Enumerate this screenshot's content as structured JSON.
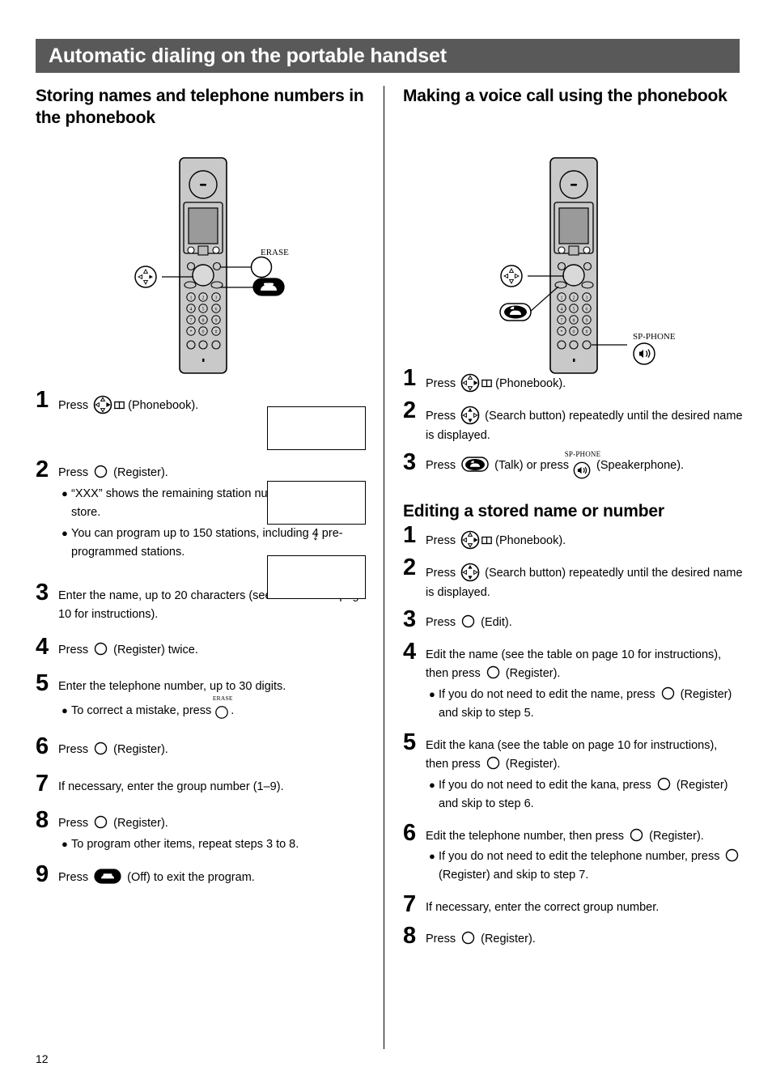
{
  "page": {
    "number": "12",
    "header_title": "Automatic dialing on the portable handset",
    "header_bg": "#595959",
    "header_fg": "#ffffff"
  },
  "left_column": {
    "section_title": "Storing names and telephone numbers in the phonebook",
    "illustration": {
      "name": "portable-handset-storing",
      "callouts": [
        {
          "label": "",
          "icon": "navigator-icon"
        },
        {
          "label": "ERASE",
          "icon": "erase-button-icon"
        },
        {
          "label": "",
          "icon": "talk-off-button-icon"
        }
      ],
      "keypad": [
        "1",
        "2",
        "3",
        "4",
        "5",
        "6",
        "7",
        "8",
        "9",
        "*",
        "0",
        "#"
      ]
    },
    "displays": [
      {
        "name": "lcd-display-1",
        "text": ""
      },
      {
        "name": "lcd-display-2",
        "text": ""
      },
      {
        "name": "lcd-display-3",
        "text": ""
      }
    ],
    "display_arrow": "↓",
    "steps": [
      {
        "num": "1",
        "parts": [
          {
            "t": "text",
            "v": "Press "
          },
          {
            "t": "icon",
            "v": "navigator-phonebook-icon"
          },
          {
            "t": "text",
            "v": " (Phonebook)."
          }
        ],
        "subs": []
      },
      {
        "num": "2",
        "parts": [
          {
            "t": "text",
            "v": "Press "
          },
          {
            "t": "icon",
            "v": "register-button-icon"
          },
          {
            "t": "text",
            "v": " (Register)."
          }
        ],
        "subs": [
          {
            "v": "“XXX” shows the remaining station numbers you can store."
          },
          {
            "v": "You can program up to 150 stations, including 4 pre-programmed stations."
          }
        ]
      },
      {
        "num": "3",
        "parts": [
          {
            "t": "text",
            "v": "Enter the name, up to 20 characters (see the table on page 10 for instructions)."
          }
        ],
        "subs": []
      },
      {
        "num": "4",
        "parts": [
          {
            "t": "text",
            "v": "Press "
          },
          {
            "t": "icon",
            "v": "register-button-icon"
          },
          {
            "t": "text",
            "v": " (Register) twice."
          }
        ],
        "subs": []
      },
      {
        "num": "5",
        "parts": [
          {
            "t": "text",
            "v": "Enter the telephone number, up to 30 digits."
          }
        ],
        "subs": [
          {
            "pre": "To correct a mistake, press ",
            "icon": "erase-button-icon",
            "icon_label": "ERASE",
            "post": "."
          }
        ]
      },
      {
        "num": "6",
        "parts": [
          {
            "t": "text",
            "v": "Press "
          },
          {
            "t": "icon",
            "v": "register-button-icon"
          },
          {
            "t": "text",
            "v": " (Register)."
          }
        ],
        "subs": []
      },
      {
        "num": "7",
        "parts": [
          {
            "t": "text",
            "v": "If necessary, enter the group number (1–9)."
          }
        ],
        "subs": []
      },
      {
        "num": "8",
        "parts": [
          {
            "t": "text",
            "v": "Press "
          },
          {
            "t": "icon",
            "v": "register-button-icon"
          },
          {
            "t": "text",
            "v": " (Register)."
          }
        ],
        "subs": [
          {
            "v": "To program other items, repeat steps 3 to 8."
          }
        ]
      },
      {
        "num": "9",
        "parts": [
          {
            "t": "text",
            "v": "Press "
          },
          {
            "t": "icon",
            "v": "talk-off-button-icon"
          },
          {
            "t": "text",
            "v": " (Off) to exit the program."
          }
        ],
        "subs": []
      }
    ]
  },
  "right_column": {
    "section_title_1": "Making a voice call using the phonebook",
    "section_title_2": "Editing a stored name or number",
    "illustration": {
      "name": "portable-handset-voice-call",
      "callouts": [
        {
          "label": "",
          "icon": "navigator-icon"
        },
        {
          "label": "",
          "icon": "talk-button-icon"
        },
        {
          "label": "SP-PHONE",
          "icon": "speakerphone-button-icon"
        }
      ],
      "keypad": [
        "1",
        "2",
        "3",
        "4",
        "5",
        "6",
        "7",
        "8",
        "9",
        "*",
        "0",
        "#"
      ]
    },
    "steps_voice": [
      {
        "num": "1",
        "line1_pre": "Press ",
        "icon": "navigator-phonebook-icon",
        "line1_post": " (Phonebook).",
        "subs": []
      },
      {
        "num": "2",
        "line1_pre": "Press ",
        "icon": "search-button-icon",
        "line1_post": " (Search button) repeatedly until the desired name is displayed.",
        "subs": []
      },
      {
        "num": "3",
        "line1_pre": "Press ",
        "icon": "talk-button-icon",
        "line1_mid": " (Talk) or press ",
        "icon2": "speakerphone-button-icon",
        "icon2_label": "SP-PHONE",
        "line1_post": " (Speakerphone).",
        "subs": []
      }
    ],
    "steps_edit": [
      {
        "num": "1",
        "line1_pre": "Press ",
        "icon": "navigator-phonebook-icon",
        "line1_post": " (Phonebook).",
        "subs": []
      },
      {
        "num": "2",
        "line1_pre": "Press ",
        "icon": "search-button-icon",
        "line1_post": " (Search button) repeatedly until the desired name is displayed.",
        "subs": []
      },
      {
        "num": "3",
        "line1_pre": "Press ",
        "icon": "edit-button-icon",
        "line1_post": " (Edit).",
        "subs": []
      },
      {
        "num": "4",
        "line1_pre": "Edit the name (see the table on page 10 for instructions), then press ",
        "icon": "register-button-icon",
        "line1_post": " (Register).",
        "subs": [
          {
            "pre": "If you do not need to edit the name, press ",
            "icon": "register-button-icon",
            "post": " (Register) and skip to step 5."
          }
        ]
      },
      {
        "num": "5",
        "line1_pre": "Edit the kana (see the table on page 10 for instructions), then press ",
        "icon": "register-button-icon",
        "line1_post": " (Register).",
        "subs": [
          {
            "pre": "If you do not need to edit the kana, press ",
            "icon": "register-button-icon",
            "post": " (Register) and skip to step 6."
          }
        ]
      },
      {
        "num": "6",
        "line1_pre": "Edit the telephone number, then press ",
        "icon": "register-button-icon",
        "line1_post": " (Register).",
        "subs": [
          {
            "pre": "If you do not need to edit the telephone number, press ",
            "icon": "register-button-icon",
            "post": " (Register) and skip to step 7."
          }
        ]
      },
      {
        "num": "7",
        "line1_pre": "If necessary, enter the correct group number.",
        "icon": "",
        "line1_post": "",
        "subs": []
      },
      {
        "num": "8",
        "line1_pre": "Press ",
        "icon": "register-button-icon",
        "line1_post": " (Register).",
        "subs": []
      }
    ]
  }
}
